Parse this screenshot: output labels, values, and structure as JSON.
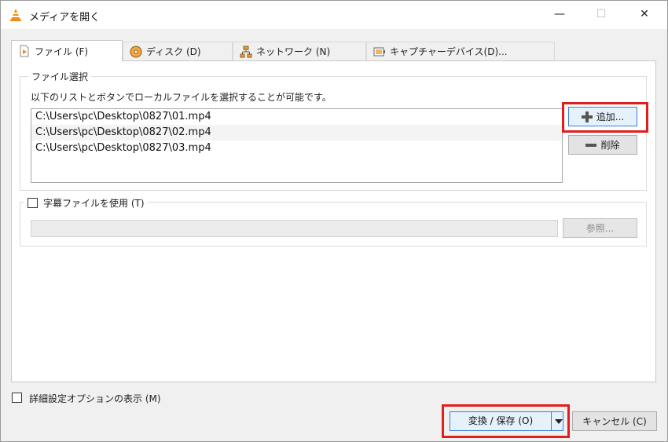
{
  "window": {
    "title": "メディアを開く",
    "minimize_glyph": "—",
    "maximize_glyph": "☐",
    "close_glyph": "✕"
  },
  "tabs": [
    {
      "label": "ファイル (F)",
      "icon": "play-file-icon",
      "active": true
    },
    {
      "label": "ディスク (D)",
      "icon": "disc-icon",
      "active": false
    },
    {
      "label": "ネットワーク (N)",
      "icon": "network-icon",
      "active": false
    },
    {
      "label": "キャプチャーデバイス(D)...",
      "icon": "capture-device-icon",
      "active": false
    }
  ],
  "file_selection": {
    "group_title": "ファイル選択",
    "description": "以下のリストとボタンでローカルファイルを選択することが可能です。",
    "files": [
      "C:\\Users\\pc\\Desktop\\0827\\01.mp4",
      "C:\\Users\\pc\\Desktop\\0827\\02.mp4",
      "C:\\Users\\pc\\Desktop\\0827\\03.mp4"
    ],
    "add_label": "追加...",
    "remove_label": "削除"
  },
  "subtitle": {
    "checkbox_label": "字幕ファイルを使用 (T)",
    "checked": false,
    "path_value": "",
    "browse_label": "参照..."
  },
  "footer": {
    "advanced_label": "詳細設定オプションの表示 (M)",
    "advanced_checked": false,
    "convert_label": "変換 / 保存 (O)",
    "cancel_label": "キャンセル (C)"
  },
  "colors": {
    "highlight": "#e01e1e",
    "focus": "#3c7fd5",
    "vlc_orange": "#f28c12"
  }
}
